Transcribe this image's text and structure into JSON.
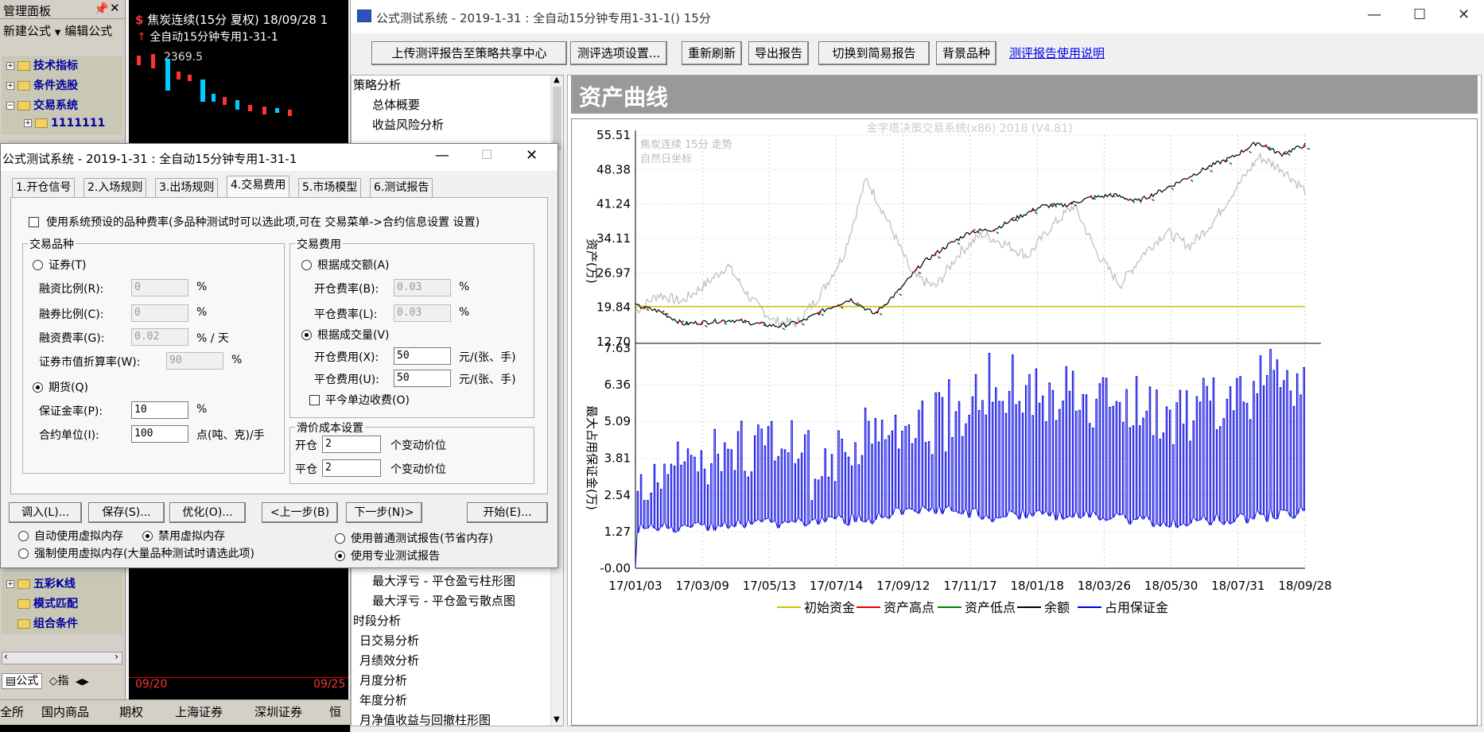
{
  "left_panel": {
    "title": "管理面板",
    "new_formula": "新建公式",
    "edit_formula": "编辑公式",
    "tree_top": [
      "技术指标",
      "条件选股",
      "交易系统",
      "1111111"
    ],
    "tree_bottom": [
      "五彩K线",
      "模式匹配",
      "组合条件"
    ],
    "tab_formula": "公式",
    "tab_indicator": "指"
  },
  "mini_chart": {
    "title": "焦炭连续(15分 夏权) 18/09/28 1",
    "subtitle": "全自动15分钟专用1-31-1",
    "price": "2369.5",
    "date_left": "09/20",
    "date_right": "09/25"
  },
  "bottom_bar": [
    "全所",
    "国内商品",
    "期权",
    "上海证券",
    "深圳证券",
    "恒"
  ],
  "main_window": {
    "title": "公式测试系统 - 2019-1-31 : 全自动15分钟专用1-31-1() 15分",
    "toolbar": {
      "upload": "上传测评报告至策略共享中心",
      "options": "测评选项设置...",
      "refresh": "重新刷新",
      "export": "导出报告",
      "switch": "切换到简易报告",
      "background": "背景品种",
      "help_link": "测评报告使用说明"
    },
    "nav": {
      "items_top": [
        "策略分析",
        "总体概要",
        "收益风险分析"
      ],
      "items_bottom": [
        "最大浮亏 - 平仓盈亏柱形图",
        "最大浮亏 - 平仓盈亏散点图",
        "时段分析",
        "日交易分析",
        "月绩效分析",
        "月度分析",
        "年度分析",
        "月净值收益与回撤柱形图"
      ]
    },
    "banner": "资产曲线"
  },
  "dialog": {
    "title": "公式测试系统 - 2019-1-31 : 全自动15分钟专用1-31-1",
    "tabs": [
      "1.开仓信号",
      "2.入场规则",
      "3.出场规则",
      "4.交易费用",
      "5.市场模型",
      "6.测试报告"
    ],
    "use_system_fee": "使用系统预设的品种费率(多品种测试时可以选此项,可在 交易菜单->合约信息设置 设置)",
    "group_variety": "交易品种",
    "securities": "证券(T)",
    "margin_ratio_label": "融资比例(R):",
    "margin_ratio": "0",
    "short_ratio_label": "融券比例(C):",
    "short_ratio": "0",
    "margin_fee_label": "融资费率(G):",
    "margin_fee": "0.02",
    "per_day": "% / 天",
    "discount_label": "证券市值折算率(W):",
    "discount": "90",
    "pct": "%",
    "futures": "期货(Q)",
    "deposit_label": "保证金率(P):",
    "deposit": "10",
    "unit_label": "合约单位(I):",
    "unit": "100",
    "unit_suffix": "点(吨、克)/手",
    "group_fee": "交易费用",
    "by_amount": "根据成交额(A)",
    "open_rate_label": "开仓费率(B):",
    "open_rate": "0.03",
    "close_rate_label": "平仓费率(L):",
    "close_rate": "0.03",
    "by_volume": "根据成交量(V)",
    "open_fee_label": "开仓费用(X):",
    "open_fee": "50",
    "close_fee_label": "平仓费用(U):",
    "close_fee": "50",
    "fee_unit": "元/(张、手)",
    "single_side": "平今单边收费(O)",
    "group_slip": "滑价成本设置",
    "slip_open_label": "开仓",
    "slip_open": "2",
    "slip_close_label": "平仓",
    "slip_close": "2",
    "slip_unit": "个变动价位",
    "btn_load": "调入(L)...",
    "btn_save": "保存(S)...",
    "btn_optimize": "优化(O)...",
    "btn_prev": "<上一步(B)",
    "btn_next": "下一步(N)>",
    "btn_start": "开始(E)...",
    "auto_vm": "自动使用虚拟内存",
    "disable_vm": "禁用虚拟内存",
    "force_vm": "强制使用虚拟内存(大量品种测试时请选此项)",
    "normal_report": "使用普通测试报告(节省内存)",
    "pro_report": "使用专业测试报告"
  },
  "chart_data": {
    "type": "line",
    "watermark": "金字塔决策交易系统(x86) 2018 (V4.81)",
    "overlay_title": "焦炭连续 15分 走势",
    "overlay_subtitle": "自然日坐标",
    "ylabel_top": "资产(万)",
    "ylabel_bottom": "最大占用保证金(万)",
    "y_ticks_top": [
      "55.51",
      "48.38",
      "41.24",
      "34.11",
      "26.97",
      "19.84",
      "12.70"
    ],
    "y_ticks_bottom": [
      "7.63",
      "6.36",
      "5.09",
      "3.81",
      "2.54",
      "1.27",
      "-0.00"
    ],
    "x_ticks": [
      "17/01/03",
      "17/03/09",
      "17/05/13",
      "17/07/14",
      "17/09/12",
      "17/11/17",
      "18/01/18",
      "18/03/26",
      "18/05/30",
      "18/07/31",
      "18/09/28"
    ],
    "ylim_top": [
      12.7,
      55.51
    ],
    "ylim_bottom": [
      0,
      7.63
    ],
    "initial_capital": 20.0,
    "balance": [
      20.2,
      19.0,
      16.4,
      16.8,
      17.2,
      16.5,
      15.9,
      17.0,
      19.5,
      21.5,
      18.4,
      23.2,
      29.0,
      32.5,
      35.5,
      36.0,
      38.5,
      40.8,
      41.0,
      42.5,
      43.1,
      41.8,
      44.0,
      46.5,
      49.0,
      51.0,
      54.0,
      51.5,
      53.5
    ],
    "underlying": [
      19.0,
      22.5,
      21.0,
      24.5,
      28.5,
      21.5,
      17.0,
      16.5,
      22.5,
      30.5,
      46.5,
      37.0,
      26.5,
      24.0,
      31.0,
      35.0,
      33.0,
      30.5,
      36.5,
      41.0,
      31.0,
      24.5,
      31.0,
      35.5,
      32.5,
      37.5,
      44.5,
      51.0,
      48.5,
      44.0
    ],
    "margin_base": [
      1.5,
      1.6,
      1.7,
      1.8,
      1.8,
      1.9,
      2.1,
      2.2,
      2.0,
      2.1,
      2.0,
      1.9,
      1.8,
      1.9,
      2.0,
      2.1
    ],
    "margin_peak": [
      3.5,
      4.7,
      4.5,
      5.3,
      4.3,
      5.0,
      5.5,
      6.2,
      7.3,
      6.8,
      6.8,
      6.4,
      6.2,
      6.5,
      7.2,
      7.6
    ],
    "series": [
      {
        "name": "初始资金",
        "color": "#c8c800"
      },
      {
        "name": "资产高点",
        "color": "#e00000"
      },
      {
        "name": "资产低点",
        "color": "#008000"
      },
      {
        "name": "余额",
        "color": "#000000"
      },
      {
        "name": "占用保证金",
        "color": "#0000e0"
      }
    ]
  }
}
